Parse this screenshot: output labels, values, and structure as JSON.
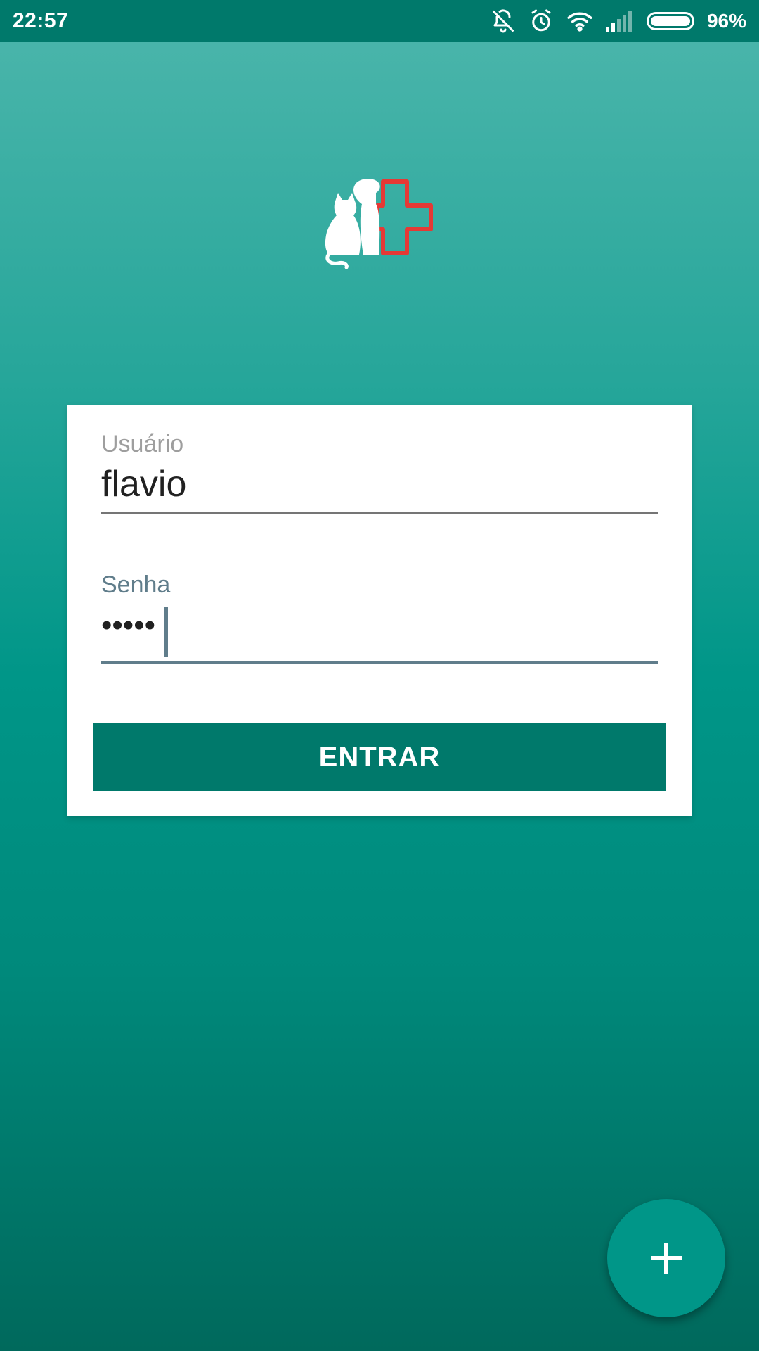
{
  "status_bar": {
    "time": "22:57",
    "battery_percent": "96%",
    "icons": [
      "bell-off-icon",
      "alarm-icon",
      "wifi-icon",
      "signal-icon",
      "battery-icon"
    ]
  },
  "logo": {
    "icon": "pet-cross-logo",
    "colors": {
      "pets": "#ffffff",
      "cross": "#e53935"
    }
  },
  "login": {
    "username_label": "Usuário",
    "username_value": "flavio",
    "password_label": "Senha",
    "password_value": "•••••",
    "submit_label": "ENTRAR"
  },
  "fab": {
    "icon": "plus-icon"
  },
  "colors": {
    "primary": "#009688",
    "primary_dark": "#00796b",
    "accent_cross": "#e53935",
    "focus_line": "#607d8b"
  }
}
